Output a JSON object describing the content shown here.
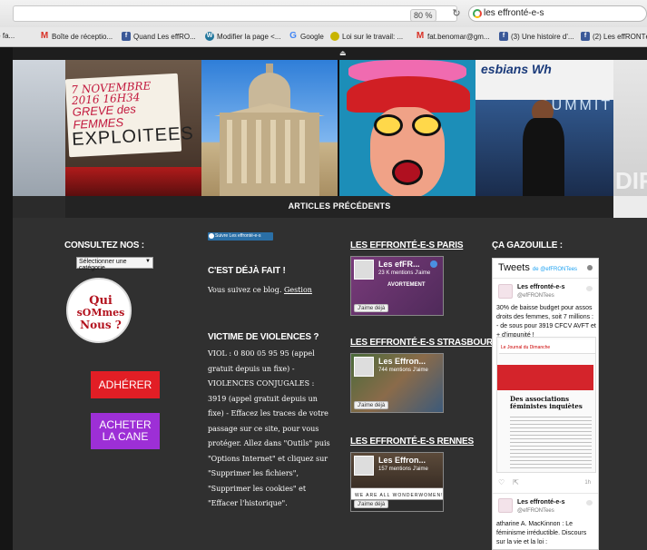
{
  "browser": {
    "zoom": "80 %",
    "search_value": "les effronté-e-s",
    "bookmarks": [
      {
        "icon": "partial",
        "label": "- fa..."
      },
      {
        "icon": "gmail-icon",
        "label": "Boîte de réceptio..."
      },
      {
        "icon": "facebook-icon",
        "label": "Quand Les effRO..."
      },
      {
        "icon": "wordpress-icon",
        "label": "Modifier la page <..."
      },
      {
        "icon": "google-icon",
        "label": "Google"
      },
      {
        "icon": "site-icon",
        "label": "Loi sur le travail: ..."
      },
      {
        "icon": "gmail-icon",
        "label": "fat.benomar@gm..."
      },
      {
        "icon": "facebook-icon",
        "label": "(3) Une histoire d'..."
      },
      {
        "icon": "facebook-icon",
        "label": "(2) Les effRONTé"
      }
    ]
  },
  "carousel": {
    "sign_line1": "7 NOVEMBRE 2016 16H34",
    "sign_line2": "GREVE des FEMMES",
    "sign_line3": "EXPLOITEES",
    "summit_top": "esbians Wh",
    "summit_word": "SUMMIT",
    "side_text": "DIF"
  },
  "prev_bar": "ARTICLES PRÉCÉDENTS",
  "col1": {
    "title": "CONSULTEZ NOS :",
    "select_value": "Sélectionner une catégorie",
    "qui_line1": "Qui",
    "qui_line2": "sOMmes",
    "qui_line3": "Nous ?",
    "btn_adherer": "ADHÉRER",
    "btn_cane_1": "ACHETER",
    "btn_cane_2": "LA CANE"
  },
  "col2": {
    "follow_btn": "Suivre Les effronté-e-s",
    "deja_title": "C'EST DÉJÀ FAIT !",
    "deja_text": "Vous suivez ce blog.",
    "deja_link": "Gestion",
    "viol_title": "VICTIME DE VIOLENCES ?",
    "viol_text": "VIOL : 0 800 05 95 95 (appel gratuit depuis un fixe) - VIOLENCES CONJUGALES : 3919 (appel gratuit depuis un fixe) - Effacez les traces de votre passage sur ce site, pour vous protéger. Allez dans \"Outils\" puis \"Options Internet\" et cliquez sur \"Supprimer les fichiers\", \"Supprimer les cookies\" et \"Effacer l'historique\"."
  },
  "col3": {
    "paris_title": "LES EFFRONTÉ-E-S PARIS",
    "paris_name": "Les efFR...",
    "paris_likes": "23 K mentions J'aime",
    "paris_banner": "AVORTEMENT",
    "strasbourg_title": "LES EFFRONTÉ-E-S STRASBOURG",
    "strasbourg_name": "Les Effron...",
    "strasbourg_likes": "744 mentions J'aime",
    "rennes_title": "LES EFFRONTÉ-E-S RENNES",
    "rennes_name": "Les Effron...",
    "rennes_likes": "157 mentions J'aime",
    "rennes_banner": "WE ARE ALL WONDERWOMEN!",
    "like_btn": "J'aime déjà"
  },
  "col4": {
    "title": "ÇA GAZOUILLE :",
    "tw_header": "Tweets",
    "tw_by": "de @efFRONTees",
    "tw1_name": "Les effronté-e-s",
    "tw1_handle": "@efFRONTees",
    "tw1_text": "30% de baisse budget pour assos droits des femmes, soit 7 millions : - de sous pour 3919 CFCV AVFT et + d'impunité !",
    "tw1_img_paper": "Le Journal du Dimanche",
    "tw1_img_title": "Des associations féministes inquiètes",
    "tw1_count": "1h",
    "tw2_name": "Les effronté-e-s",
    "tw2_handle": "@efFRONTees",
    "tw2_text": "atharine A. MacKinnon : Le féminisme irréductible. Discours sur la vie et la loi :"
  }
}
